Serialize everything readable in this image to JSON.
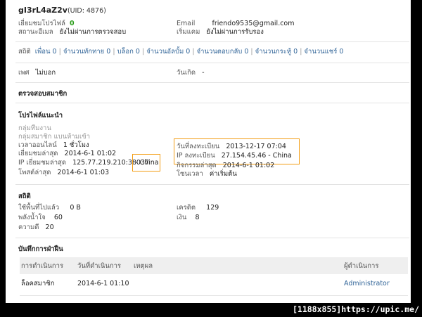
{
  "profile": {
    "username": "gI3rL4aZ2v",
    "uid_text": "(UID: 4876)",
    "visit_label": "เยี่ยมชมโปรไฟล์",
    "visit_value": "0",
    "email_label": "Email",
    "email_value": "friendo9535@gmail.com",
    "email_status_label": "สถานะอีเมล",
    "email_status_value": "ยังไม่ผ่านการตรวจสอบ",
    "verify_label": "เริ่มแคม",
    "verify_value": "ยังไม่ผ่านการรับรอง"
  },
  "stats_links": {
    "label": "สถิติ",
    "items": [
      {
        "label": "เพื่อน 0"
      },
      {
        "label": "จำนวนทักทาย 0"
      },
      {
        "label": "บล็อก 0"
      },
      {
        "label": "จำนวนอัลบั้ม 0"
      },
      {
        "label": "จำนวนตอบกลับ 0"
      },
      {
        "label": "จำนวนกระทู้ 0"
      },
      {
        "label": "จำนวนแชร์ 0"
      }
    ],
    "separator": "|"
  },
  "basic": {
    "gender_label": "เพศ",
    "gender_value": "ไม่บอก",
    "birthday_label": "วันเกิด",
    "birthday_value": "-"
  },
  "sections": {
    "verify_member": "ตรวจสอบสมาชิก",
    "profile_recommend": "โปรไฟล์แนะนำ",
    "stats": "สถิติ",
    "activity_log": "บันทึกการฝ่าฝืน"
  },
  "profile_detail": {
    "group_label": "กลุ่มทีมงาน",
    "member_group": "กลุ่มสมาชิก  แบนห้ามเข้า",
    "online_label": "เวลาออนไลน์",
    "online_value": "1 ชั่วโมง",
    "last_visit_label": "เยี่ยมชมล่าสุด",
    "last_visit_value": "2014-6-1 01:02",
    "last_ip_label": "IP เยี่ยมชมล่าสุด",
    "last_ip_value": "125.77.219.210:38037",
    "last_ip_country": "- China",
    "last_post_label": "โพสต์ล่าสุด",
    "last_post_value": "2014-6-1 01:03",
    "reg_date_label": "วันที่ลงทะเบียน",
    "reg_date_value": "2013-12-17 07:04",
    "reg_ip_label": "IP ลงทะเบียน",
    "reg_ip_value": "27.154.45.46 - China",
    "last_activity_label": "กิจกรรมล่าสุด",
    "last_activity_value": "2014-6-1 01:02",
    "timezone_label": "โซนเวลา",
    "timezone_value": "ค่าเริ่มต้น"
  },
  "stats_detail": {
    "space_label": "ใช้พื้นที่ไปแล้ว",
    "space_value": "0 B",
    "credit_label": "เครดิต",
    "credit_value": "129",
    "power_label": "พลังน้ำใจ",
    "power_value": "60",
    "money_label": "เงิน",
    "money_value": "8",
    "good_label": "ความดี",
    "good_value": "20"
  },
  "log_table": {
    "headers": [
      "การดำเนินการ",
      "วันที่ดำเนินการ",
      "เหตุผล",
      "ผู้ดำเนินการ"
    ],
    "rows": [
      {
        "action": "ล็อคสมาชิก",
        "date": "2014-6-1 01:10",
        "reason": "",
        "operator": "Administrator"
      }
    ]
  },
  "watermark": "[1188x855]https://upic.me/",
  "colors": {
    "highlight": "#f39c12",
    "link": "#336699",
    "green": "#2a9d1a"
  }
}
